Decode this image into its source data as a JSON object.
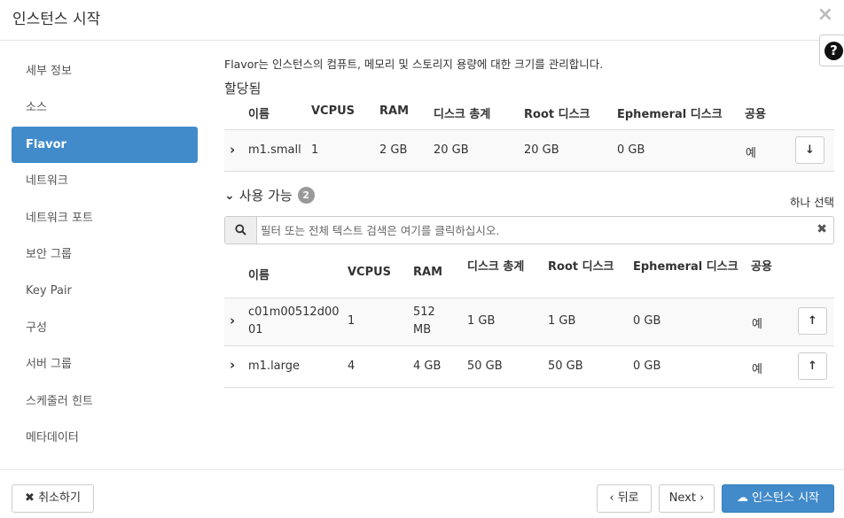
{
  "window": {
    "title": "인스턴스 시작",
    "close": "×",
    "help": "?"
  },
  "sidebar": {
    "items": [
      {
        "label": "세부 정보"
      },
      {
        "label": "소스"
      },
      {
        "label": "Flavor",
        "active": true
      },
      {
        "label": "네트워크"
      },
      {
        "label": "네트워크 포트"
      },
      {
        "label": "보안 그룹"
      },
      {
        "label": "Key Pair"
      },
      {
        "label": "구성"
      },
      {
        "label": "서버 그룹"
      },
      {
        "label": "스케줄러 힌트"
      },
      {
        "label": "메타데이터"
      }
    ]
  },
  "main": {
    "description": "Flavor는 인스턴스의 컴퓨트, 메모리 및 스토리지 용량에 대한 크기를 관리합니다.",
    "allocated": {
      "title": "할당됨",
      "columns": [
        "이름",
        "VCPUS",
        "RAM",
        "디스크 총계",
        "Root 디스크",
        "Ephemeral 디스크",
        "공용"
      ],
      "rows": [
        {
          "name": "m1.small",
          "vcpus": "1",
          "ram": "2 GB",
          "total_disk": "20 GB",
          "root_disk": "20 GB",
          "ephemeral": "0 GB",
          "public": "예"
        }
      ]
    },
    "available": {
      "title": "사용 가능",
      "count": "2",
      "select_hint": "하나 선택",
      "search_placeholder": "필터 또는 전체 텍스트 검색은 여기를 클릭하십시오.",
      "columns": [
        "이름",
        "VCPUS",
        "RAM",
        "디스크 총계",
        "Root 디스크",
        "Ephemeral 디스크",
        "공용"
      ],
      "rows": [
        {
          "name_line1": "c01m00512d00",
          "name_line2": "01",
          "vcpus": "1",
          "ram_line1": "512",
          "ram_line2": "MB",
          "total_disk": "1 GB",
          "root_disk": "1 GB",
          "ephemeral": "0 GB",
          "public": "예"
        },
        {
          "name": "m1.large",
          "vcpus": "4",
          "ram": "4 GB",
          "total_disk": "50 GB",
          "root_disk": "50 GB",
          "ephemeral": "0 GB",
          "public": "예"
        }
      ]
    }
  },
  "footer": {
    "cancel": "취소하기",
    "back": "‹ 뒤로",
    "next": "Next ›",
    "launch": "인스턴스 시작"
  },
  "colors": {
    "accent": "#428bca"
  }
}
